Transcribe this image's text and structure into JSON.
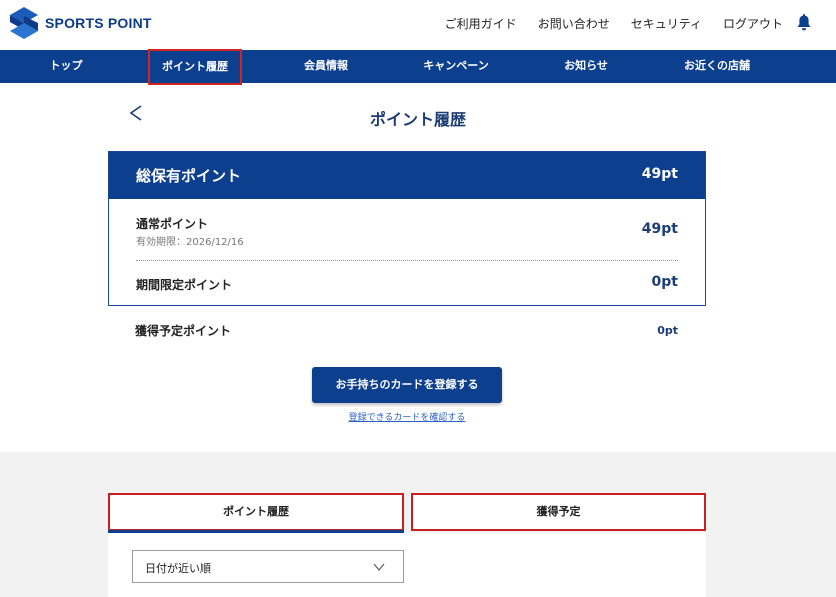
{
  "header": {
    "brand": "SPORTS POINT",
    "links": [
      "ご利用ガイド",
      "お問い合わせ",
      "セキュリティ",
      "ログアウト"
    ]
  },
  "nav": {
    "items": [
      {
        "label": "トップ"
      },
      {
        "label": "ポイント履歴",
        "active": true
      },
      {
        "label": "会員情報"
      },
      {
        "label": "キャンペーン"
      },
      {
        "label": "お知らせ"
      },
      {
        "label": "お近くの店舗"
      }
    ]
  },
  "page": {
    "title": "ポイント履歴"
  },
  "points": {
    "total_label": "総保有ポイント",
    "total_value": "49pt",
    "normal_label": "通常ポイント",
    "normal_expiry": "有効期限：2026/12/16",
    "normal_value": "49pt",
    "limited_label": "期間限定ポイント",
    "limited_value": "0pt"
  },
  "expected": {
    "label": "獲得予定ポイント",
    "value": "0pt"
  },
  "card_register": {
    "button_label": "お手持ちのカードを登録する",
    "link_label": "登録できるカードを確認する"
  },
  "tabs": [
    {
      "label": "ポイント履歴",
      "selected": true
    },
    {
      "label": "獲得予定",
      "selected": false
    }
  ],
  "sort": {
    "selected": "日付が近い順"
  },
  "colors": {
    "brand": "#0d3f8f",
    "highlight": "#d32424",
    "value_text": "#1c3d74"
  },
  "icons": {
    "logo": "sports-point-logo",
    "bell": "bell-icon",
    "back": "chevron-left-icon",
    "dropdown": "chevron-down-icon"
  }
}
